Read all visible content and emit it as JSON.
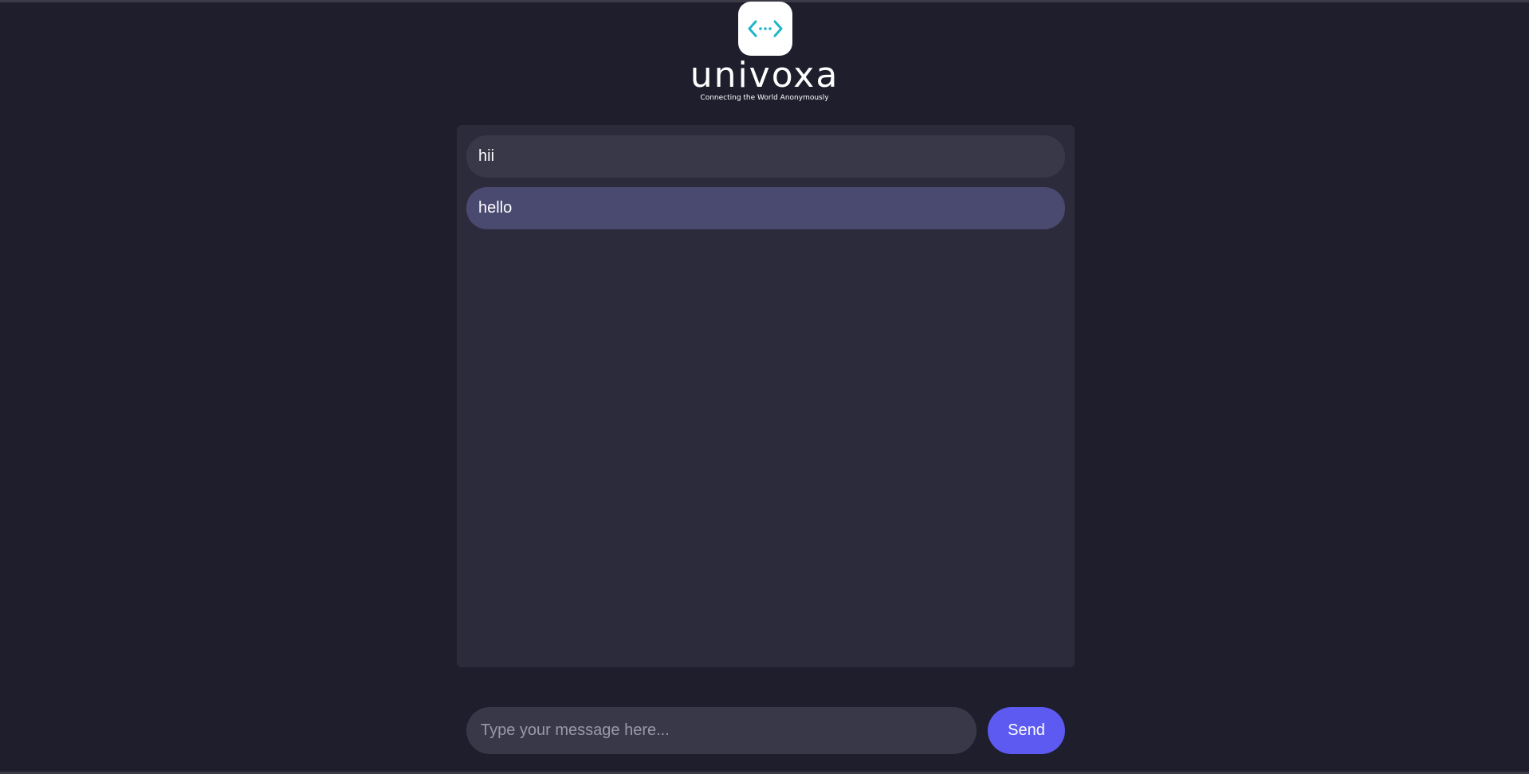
{
  "brand": {
    "name": "univoxa",
    "tagline": "Connecting the World Anonymously",
    "logo_icon": "code-arrows-icon",
    "accent_color": "#1fb6c9"
  },
  "messages": [
    {
      "text": "hii"
    },
    {
      "text": "hello"
    }
  ],
  "composer": {
    "placeholder": "Type your message here...",
    "value": "",
    "send_label": "Send",
    "send_color": "#5c5af0"
  }
}
